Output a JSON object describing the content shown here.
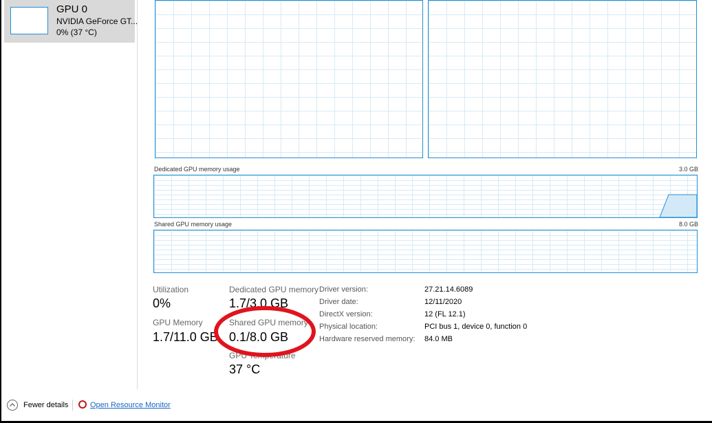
{
  "sidebar": {
    "gpu": {
      "title": "GPU 0",
      "model": "NVIDIA GeForce GT...",
      "utilization": "0%  (37 °C)"
    }
  },
  "graphs": {
    "dedicated": {
      "label": "Dedicated GPU memory usage",
      "max": "3.0 GB"
    },
    "shared": {
      "label": "Shared GPU memory usage",
      "max": "8.0 GB"
    }
  },
  "stats": {
    "utilization": {
      "label": "Utilization",
      "value": "0%"
    },
    "gpu_memory": {
      "label": "GPU Memory",
      "value": "1.7/11.0 GB"
    },
    "dedicated": {
      "label": "Dedicated GPU memory",
      "value": "1.7/3.0 GB"
    },
    "shared": {
      "label": "Shared GPU memory",
      "value": "0.1/8.0 GB"
    },
    "temperature": {
      "label": "GPU Temperature",
      "value": "37 °C"
    }
  },
  "info": [
    {
      "label": "Driver version:",
      "value": "27.21.14.6089"
    },
    {
      "label": "Driver date:",
      "value": "12/11/2020"
    },
    {
      "label": "DirectX version:",
      "value": "12 (FL 12.1)"
    },
    {
      "label": "Physical location:",
      "value": "PCI bus 1, device 0, function 0"
    },
    {
      "label": "Hardware reserved memory:",
      "value": "84.0 MB"
    }
  ],
  "footer": {
    "fewer_details": "Fewer details",
    "resource_monitor": "Open Resource Monitor"
  },
  "colors": {
    "accent": "#1f8fd6",
    "annotation": "#e0141e",
    "selection": "#d9d9d9"
  }
}
